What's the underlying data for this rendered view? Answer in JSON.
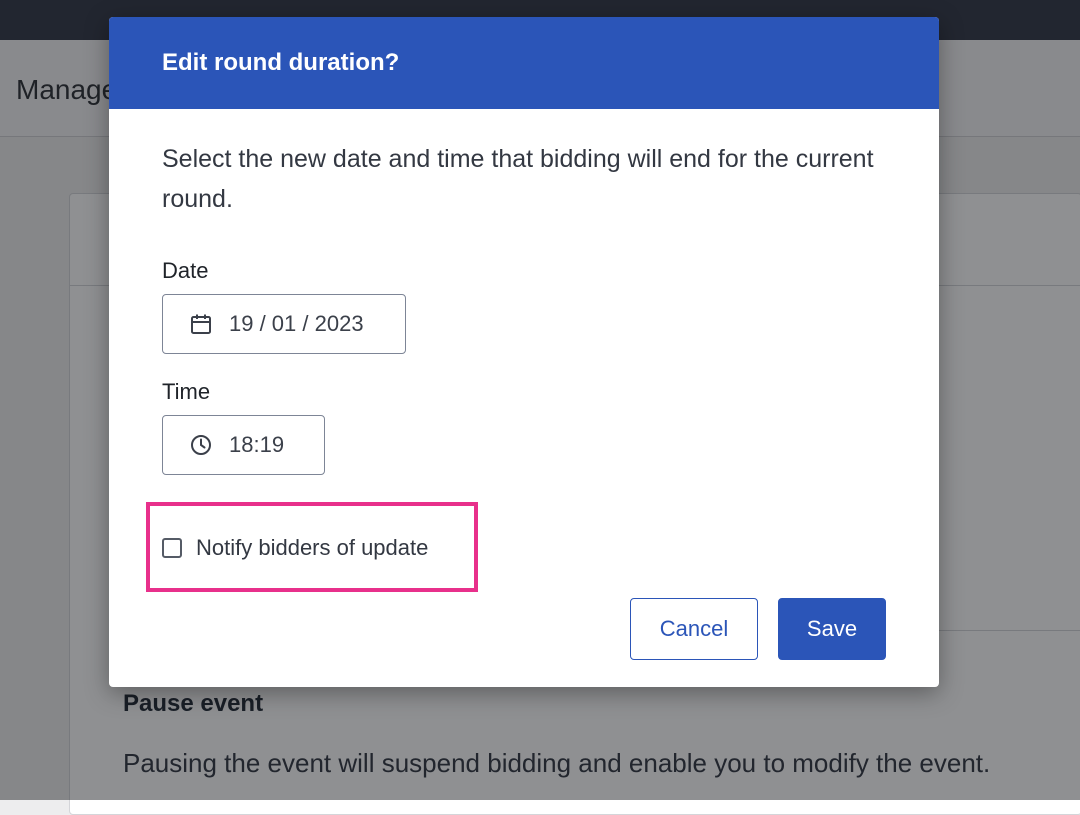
{
  "background": {
    "page_title": "Manage event",
    "pause_section": {
      "title": "Pause event",
      "description": "Pausing the event will suspend bidding and enable you to modify the event."
    }
  },
  "modal": {
    "title": "Edit round duration?",
    "description": "Select the new date and time that bidding will end for the current round.",
    "date": {
      "label": "Date",
      "value": "19 / 01 / 2023",
      "icon": "calendar-icon"
    },
    "time": {
      "label": "Time",
      "value": "18:19",
      "icon": "clock-icon"
    },
    "notify": {
      "label": "Notify bidders of update",
      "checked": false
    },
    "buttons": {
      "cancel": "Cancel",
      "save": "Save"
    }
  },
  "colors": {
    "primary": "#2b55b8",
    "highlight": "#e8308b",
    "topbar": "#2e3443"
  }
}
